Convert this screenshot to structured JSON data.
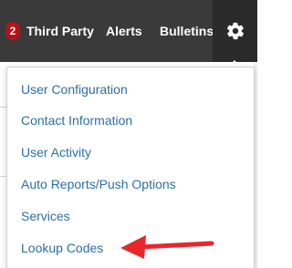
{
  "topbar": {
    "badge_count": "2",
    "nav": [
      "Third Party",
      "Alerts",
      "Bulletins"
    ],
    "settings_icon": "gear-icon",
    "colors": {
      "bar": "#3a3a3a",
      "badge": "#b5121b",
      "link": "#2a6ea6",
      "arrow": "#e8262a"
    }
  },
  "menu": {
    "items": [
      "User Configuration",
      "Contact Information",
      "User Activity",
      "Auto Reports/Push Options",
      "Services",
      "Lookup Codes"
    ],
    "highlighted_item": "Lookup Codes",
    "annotation_icon": "red-arrow-icon"
  }
}
